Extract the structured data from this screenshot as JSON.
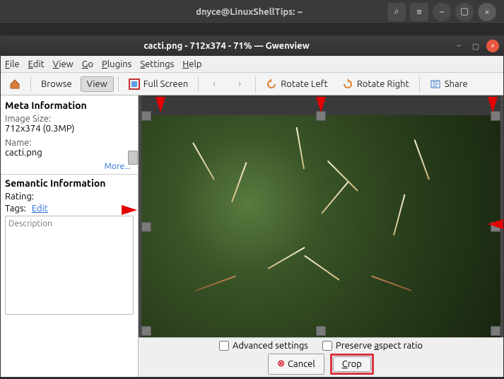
{
  "outer": {
    "title": "dnyce@LinuxShellTips: ~",
    "buttons": {
      "search": "⌕",
      "menu": "≡",
      "min": "–",
      "max": "▢",
      "close": "×"
    }
  },
  "gw": {
    "title": "cacti.png - 712x374 - 71%  — Gwenview",
    "buttons": {
      "min": "–",
      "max": "▢",
      "close": "×"
    }
  },
  "menu": {
    "file": "File",
    "edit": "Edit",
    "view": "View",
    "go": "Go",
    "plugins": "Plugins",
    "settings": "Settings",
    "help": "Help"
  },
  "toolbar": {
    "browse": "Browse",
    "view": "View",
    "fullscreen": "Full Screen",
    "rotate_left": "Rotate Left",
    "rotate_right": "Rotate Right",
    "share": "Share"
  },
  "side": {
    "meta_header": "Meta Information",
    "imgsize_label": "Image Size:",
    "imgsize_value": "712x374 (0.3MP)",
    "name_label": "Name:",
    "name_value": "cacti.png",
    "more": "More...",
    "semantic_header": "Semantic Information",
    "rating_label": "Rating:",
    "tags_label": "Tags:",
    "tags_edit": "Edit",
    "desc_placeholder": "Description"
  },
  "opts": {
    "advanced": "Advanced settings",
    "preserve": "Preserve aspect ratio",
    "cancel": "Cancel",
    "crop": "Crop"
  }
}
